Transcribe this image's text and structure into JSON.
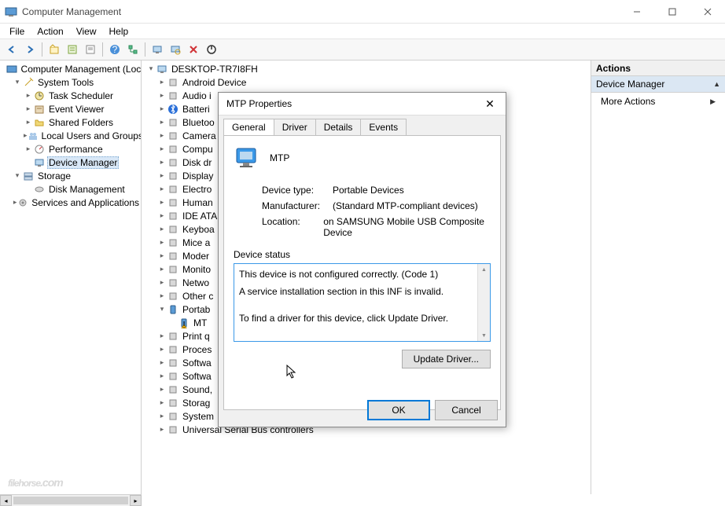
{
  "window": {
    "title": "Computer Management"
  },
  "menu": {
    "file": "File",
    "action": "Action",
    "view": "View",
    "help": "Help"
  },
  "toolbar_icons": [
    "back",
    "forward",
    "up",
    "props",
    "export",
    "help",
    "tree",
    "monitor",
    "scan",
    "delete",
    "enable"
  ],
  "left_tree": {
    "root": "Computer Management (Local",
    "system_tools": "System Tools",
    "task_scheduler": "Task Scheduler",
    "event_viewer": "Event Viewer",
    "shared_folders": "Shared Folders",
    "local_users": "Local Users and Groups",
    "performance": "Performance",
    "device_manager": "Device Manager",
    "storage": "Storage",
    "disk_management": "Disk Management",
    "services_apps": "Services and Applications"
  },
  "mid_tree": {
    "root": "DESKTOP-TR7I8FH",
    "items": [
      "Android Device",
      "Audio i",
      "Batteri",
      "Bluetoo",
      "Camera",
      "Compu",
      "Disk dr",
      "Display",
      "Electro",
      "Human",
      "IDE ATA",
      "Keyboa",
      "Mice a",
      "Moder",
      "Monito",
      "Netwo",
      "Other c",
      "Portab",
      "MT",
      "Print q",
      "Proces",
      "Softwa",
      "Softwa",
      "Sound,",
      "Storag",
      "System",
      "Universal Serial Bus controllers"
    ]
  },
  "actions": {
    "header": "Actions",
    "title": "Device Manager",
    "more": "More Actions"
  },
  "dialog": {
    "title": "MTP Properties",
    "tabs": {
      "general": "General",
      "driver": "Driver",
      "details": "Details",
      "events": "Events"
    },
    "device_name": "MTP",
    "labels": {
      "type": "Device type:",
      "mfr": "Manufacturer:",
      "loc": "Location:"
    },
    "values": {
      "type": "Portable Devices",
      "mfr": "(Standard MTP-compliant devices)",
      "loc": "on SAMSUNG Mobile USB Composite Device"
    },
    "status_label": "Device status",
    "status_lines": [
      "This device is not configured correctly. (Code 1)",
      "A service installation section in this INF is invalid.",
      "To find a driver for this device, click Update Driver."
    ],
    "update_btn": "Update Driver...",
    "ok": "OK",
    "cancel": "Cancel"
  },
  "watermark": "filehorse",
  "watermark_ext": ".com"
}
